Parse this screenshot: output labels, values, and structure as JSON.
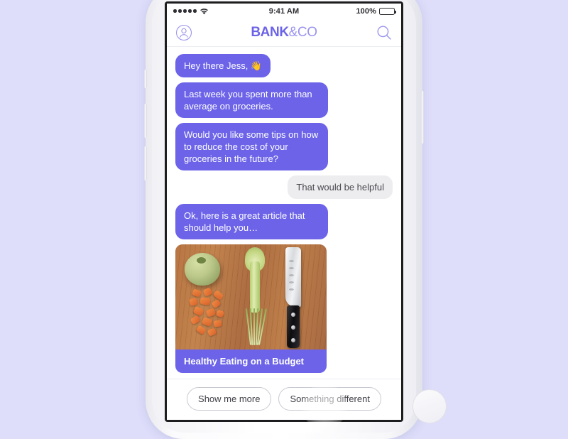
{
  "background_color": "#dedefb",
  "accent_color": "#6c63e8",
  "status_bar": {
    "signal_label": "signal-strength-5-of-5",
    "wifi_label": "wifi-icon",
    "time": "9:41 AM",
    "battery_percent": "100%",
    "battery_state": "full"
  },
  "header": {
    "profile_icon": "person-avatar-icon",
    "brand_primary": "BANK",
    "brand_secondary": "&CO",
    "search_icon": "search-icon"
  },
  "conversation": {
    "messages": [
      {
        "id": "m1",
        "sender": "bot",
        "text": "Hey there Jess, 👋"
      },
      {
        "id": "m2",
        "sender": "bot",
        "text": "Last week you spent more than average on groceries."
      },
      {
        "id": "m3",
        "sender": "bot",
        "text": "Would you like some tips on how to reduce the cost of your groceries in the future?"
      },
      {
        "id": "m4",
        "sender": "user",
        "text": "That would be helpful"
      },
      {
        "id": "m5",
        "sender": "bot",
        "text": "Ok, here is a great article that should help you…"
      }
    ],
    "article_card": {
      "image_description": "vegetables and a santoku knife on a wooden cutting board",
      "title": "Healthy Eating on a Budget"
    }
  },
  "quick_replies": [
    {
      "id": "qr-show-more",
      "label": "Show me more"
    },
    {
      "id": "qr-something-different",
      "label": "Something different"
    }
  ]
}
